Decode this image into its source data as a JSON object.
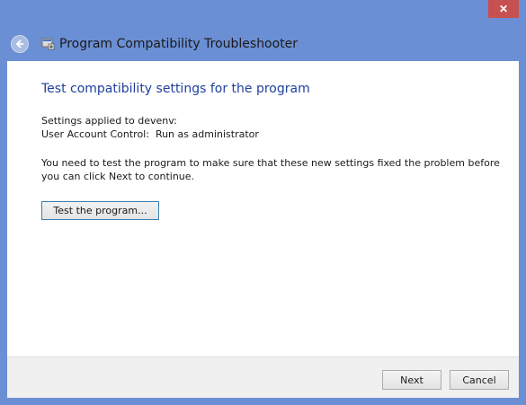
{
  "window": {
    "title": "Program Compatibility Troubleshooter",
    "close_glyph": "✕",
    "icons": {
      "back": "back-arrow-icon",
      "app": "troubleshooter-icon",
      "close": "close-icon"
    },
    "colors": {
      "frame": "#6b8fd4",
      "close_button": "#c75050",
      "heading": "#1f3f9c"
    }
  },
  "main": {
    "heading": "Test compatibility settings for the program",
    "settings_line": "Settings applied to devenv:",
    "uac_line": "User Account Control:  Run as administrator",
    "message": "You need to test the program to make sure that these new settings fixed the problem before you can click Next to continue.",
    "test_button_label": "Test the program..."
  },
  "footer": {
    "next_label": "Next",
    "cancel_label": "Cancel"
  }
}
